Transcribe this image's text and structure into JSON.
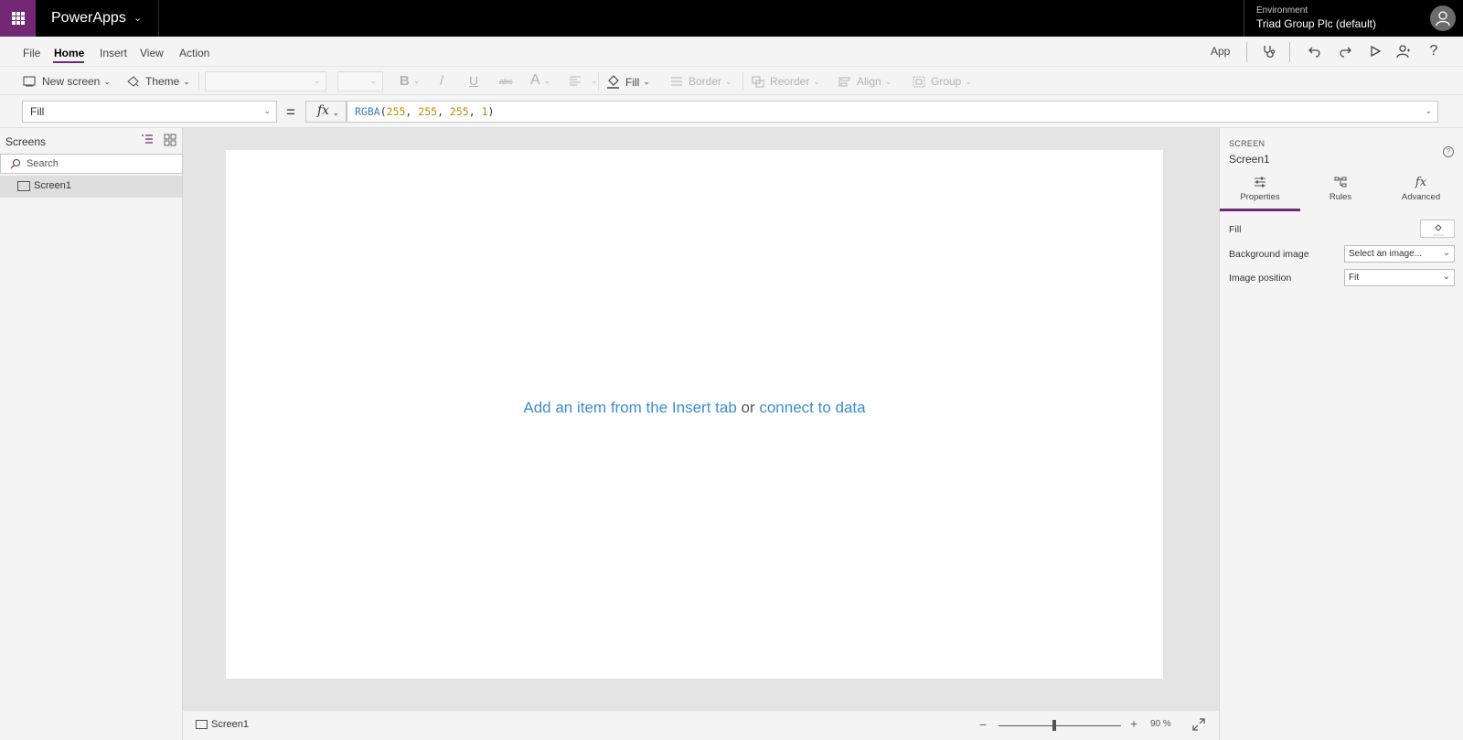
{
  "topbar": {
    "app_name": "PowerApps",
    "environment_label": "Environment",
    "environment_name": "Triad Group Plc (default)",
    "brand_color": "#742774"
  },
  "menu": {
    "items": [
      "File",
      "Home",
      "Insert",
      "View",
      "Action"
    ],
    "active": "Home",
    "right": {
      "app_label": "App",
      "icons": [
        "stethoscope-icon",
        "undo-icon",
        "redo-icon",
        "play-icon",
        "user-icon",
        "help-icon"
      ]
    }
  },
  "ribbon": {
    "new_screen": "New screen",
    "theme": "Theme",
    "fill": "Fill",
    "border": "Border",
    "reorder": "Reorder",
    "align": "Align",
    "group": "Group",
    "bold": "B",
    "italic": "/",
    "underline": "U",
    "strike": "abc",
    "font_color": "A"
  },
  "formula": {
    "property": "Fill",
    "equals": "=",
    "fx": "fx",
    "fn": "RGBA",
    "open": "(",
    "arg1": "255",
    "arg2": "255",
    "arg3": "255",
    "arg4": "1",
    "comma": ", ",
    "close": ")"
  },
  "left_panel": {
    "title": "Screens",
    "search_placeholder": "Search",
    "screens": [
      "Screen1"
    ]
  },
  "canvas": {
    "msg_link1": "Add an item from the Insert tab",
    "msg_or": " or ",
    "msg_link2": "connect to data"
  },
  "statusbar": {
    "screen": "Screen1",
    "zoom_minus": "−",
    "zoom_plus": "+",
    "zoom_value": "90 %",
    "zoom_level": 0.9
  },
  "right_panel": {
    "kind": "SCREEN",
    "name": "Screen1",
    "help": "?",
    "tabs": [
      "Properties",
      "Rules",
      "Advanced"
    ],
    "active_tab": "Properties",
    "fill_label": "Fill",
    "background_image_label": "Background image",
    "background_image_value": "Select an image...",
    "image_position_label": "Image position",
    "image_position_value": "Fit"
  }
}
